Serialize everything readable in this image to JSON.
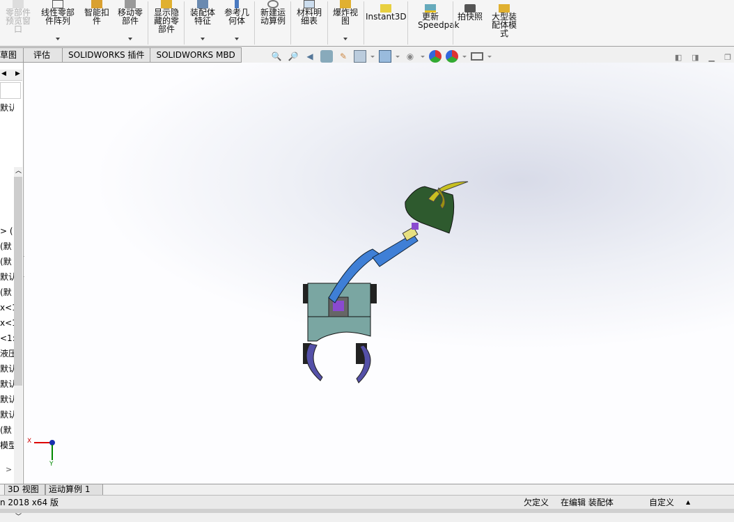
{
  "ribbon": {
    "buttons": [
      {
        "label": "零部件预览窗口",
        "disabled": true
      },
      {
        "label": "线性零部件阵列",
        "dropdown": true
      },
      {
        "label": "智能扣件"
      },
      {
        "label": "移动零部件",
        "dropdown": true
      },
      {
        "label": "显示隐藏的零部件"
      },
      {
        "label": "装配体特征",
        "dropdown": true
      },
      {
        "label": "参考几何体",
        "dropdown": true
      },
      {
        "label": "新建运动算例"
      },
      {
        "label": "材料明细表"
      },
      {
        "label": "爆炸视图",
        "dropdown": true
      },
      {
        "label": "Instant3D"
      },
      {
        "label": "更新Speedpak"
      },
      {
        "label": "拍快照"
      },
      {
        "label": "大型装配体模式"
      }
    ]
  },
  "tabs": [
    "草图",
    "评估",
    "SOLIDWORKS 插件",
    "SOLIDWORKS MBD"
  ],
  "tree": {
    "rows": [
      "默认",
      "> (",
      "(默",
      "(默",
      "默认",
      "(默",
      "x<1",
      "x<1",
      "<1:",
      "液压",
      "默认",
      "默认",
      "默认",
      "默认",
      "(默",
      "模型"
    ]
  },
  "triad": {
    "x": "X",
    "y": "Y"
  },
  "bottom_tabs": [
    "3D 视图",
    "运动算例 1"
  ],
  "status": {
    "version": "n 2018 x64 版",
    "definition": "欠定义",
    "editing": "在编辑 装配体",
    "custom": "自定义"
  },
  "colors": {
    "body": "#7aa6a2",
    "arm": "#3f7fd6",
    "gripper": "#2e5a2e",
    "tracks": "#5450a8",
    "yellow": "#c8c020"
  }
}
